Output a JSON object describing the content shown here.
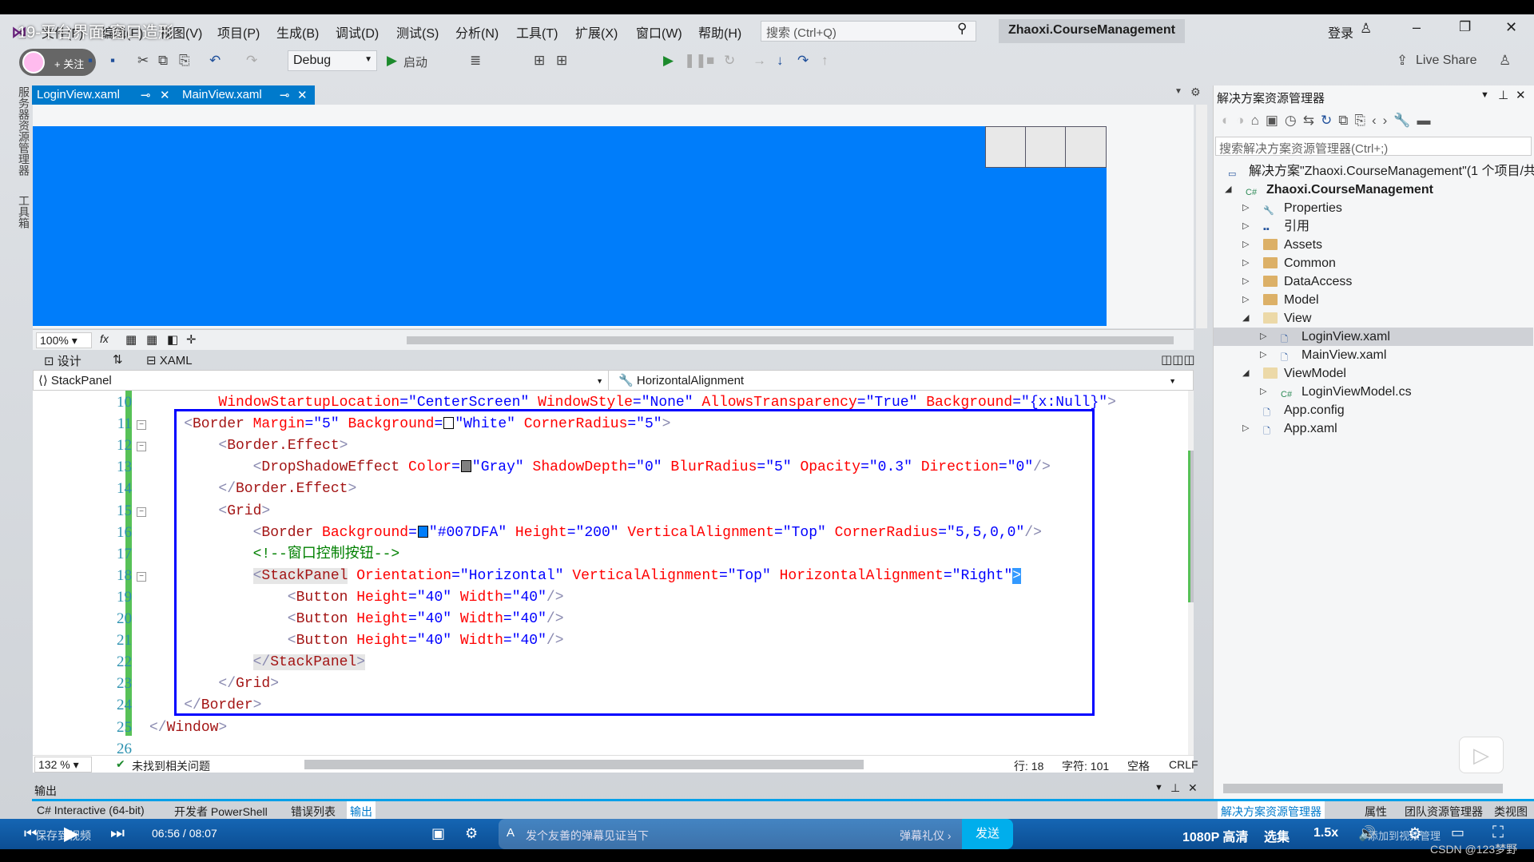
{
  "video": {
    "title": "19-平台界面-窗口造形",
    "follow": "+ 关注",
    "time": "06:56 / 08:07",
    "save": "保存到视频",
    "danmaku_placeholder": "发个友善的弹幕见证当下",
    "danmaku_etiquette": "弹幕礼仪 ›",
    "send": "发送",
    "quality": "1080P 高清",
    "episodes": "选集",
    "speed": "1.5x",
    "add_to_playlist": "添加到视频管理",
    "watermark": "CSDN @123梦野"
  },
  "menu": [
    "文件(F)",
    "编辑(E)",
    "视图(V)",
    "项目(P)",
    "生成(B)",
    "调试(D)",
    "测试(S)",
    "分析(N)",
    "工具(T)",
    "扩展(X)",
    "窗口(W)",
    "帮助(H)"
  ],
  "search": {
    "placeholder": "搜索 (Ctrl+Q)"
  },
  "project_name": "Zhaoxi.CourseManagement",
  "account": {
    "login": "登录"
  },
  "toolbar": {
    "config": "Debug",
    "start": "启动",
    "live_share": "Live Share"
  },
  "left_strip": [
    "服务器资源管理器",
    "工具箱"
  ],
  "tabs": [
    {
      "label": "LoginView.xaml",
      "active": true
    },
    {
      "label": "MainView.xaml",
      "active": false
    }
  ],
  "designer": {
    "zoom": "100%",
    "background": "#007DFA",
    "design_tab": "设计",
    "xaml_tab": "XAML"
  },
  "nav": {
    "element": "StackPanel",
    "member": "HorizontalAlignment"
  },
  "code": [
    {
      "n": "10",
      "i": 8,
      "t": [
        [
          "at",
          "WindowStartupLocation"
        ],
        [
          "q",
          "=\""
        ],
        [
          "v",
          "CenterScreen"
        ],
        [
          "q",
          "\" "
        ],
        [
          "at",
          "WindowStyle"
        ],
        [
          "q",
          "=\""
        ],
        [
          "v",
          "None"
        ],
        [
          "q",
          "\" "
        ],
        [
          "at",
          "AllowsTransparency"
        ],
        [
          "q",
          "=\""
        ],
        [
          "v",
          "True"
        ],
        [
          "q",
          "\" "
        ],
        [
          "at",
          "Background"
        ],
        [
          "q",
          "=\""
        ],
        [
          "v",
          "{x:Null}"
        ],
        [
          "q",
          "\""
        ],
        [
          "br",
          ">"
        ]
      ]
    },
    {
      "n": "11",
      "i": 4,
      "t": [
        [
          "br",
          "<"
        ],
        [
          "el",
          "Border"
        ],
        [
          "t",
          " "
        ],
        [
          "at",
          "Margin"
        ],
        [
          "q",
          "=\""
        ],
        [
          "v",
          "5"
        ],
        [
          "q",
          "\" "
        ],
        [
          "at",
          "Background"
        ],
        [
          "q",
          "="
        ],
        [
          "sw",
          "#FFFFFF"
        ],
        [
          "q",
          "\""
        ],
        [
          "v",
          "White"
        ],
        [
          "q",
          "\" "
        ],
        [
          "at",
          "CornerRadius"
        ],
        [
          "q",
          "=\""
        ],
        [
          "v",
          "5"
        ],
        [
          "q",
          "\""
        ],
        [
          "br",
          ">"
        ]
      ]
    },
    {
      "n": "12",
      "i": 8,
      "t": [
        [
          "br",
          "<"
        ],
        [
          "el",
          "Border.Effect"
        ],
        [
          "br",
          ">"
        ]
      ]
    },
    {
      "n": "13",
      "i": 12,
      "t": [
        [
          "br",
          "<"
        ],
        [
          "el",
          "DropShadowEffect"
        ],
        [
          "t",
          " "
        ],
        [
          "at",
          "Color"
        ],
        [
          "q",
          "="
        ],
        [
          "sw",
          "#808080"
        ],
        [
          "q",
          "\""
        ],
        [
          "v",
          "Gray"
        ],
        [
          "q",
          "\" "
        ],
        [
          "at",
          "ShadowDepth"
        ],
        [
          "q",
          "=\""
        ],
        [
          "v",
          "0"
        ],
        [
          "q",
          "\" "
        ],
        [
          "at",
          "BlurRadius"
        ],
        [
          "q",
          "=\""
        ],
        [
          "v",
          "5"
        ],
        [
          "q",
          "\" "
        ],
        [
          "at",
          "Opacity"
        ],
        [
          "q",
          "=\""
        ],
        [
          "v",
          "0.3"
        ],
        [
          "q",
          "\" "
        ],
        [
          "at",
          "Direction"
        ],
        [
          "q",
          "=\""
        ],
        [
          "v",
          "0"
        ],
        [
          "q",
          "\""
        ],
        [
          "br",
          "/>"
        ]
      ]
    },
    {
      "n": "14",
      "i": 8,
      "t": [
        [
          "br",
          "</"
        ],
        [
          "el",
          "Border.Effect"
        ],
        [
          "br",
          ">"
        ]
      ]
    },
    {
      "n": "15",
      "i": 8,
      "t": [
        [
          "br",
          "<"
        ],
        [
          "el",
          "Grid"
        ],
        [
          "br",
          ">"
        ]
      ]
    },
    {
      "n": "16",
      "i": 12,
      "t": [
        [
          "br",
          "<"
        ],
        [
          "el",
          "Border"
        ],
        [
          "t",
          " "
        ],
        [
          "at",
          "Background"
        ],
        [
          "q",
          "="
        ],
        [
          "sw",
          "#007DFA"
        ],
        [
          "q",
          "\""
        ],
        [
          "v",
          "#007DFA"
        ],
        [
          "q",
          "\" "
        ],
        [
          "at",
          "Height"
        ],
        [
          "q",
          "=\""
        ],
        [
          "v",
          "200"
        ],
        [
          "q",
          "\" "
        ],
        [
          "at",
          "VerticalAlignment"
        ],
        [
          "q",
          "=\""
        ],
        [
          "v",
          "Top"
        ],
        [
          "q",
          "\" "
        ],
        [
          "at",
          "CornerRadius"
        ],
        [
          "q",
          "=\""
        ],
        [
          "v",
          "5,5,0,0"
        ],
        [
          "q",
          "\""
        ],
        [
          "br",
          "/>"
        ]
      ]
    },
    {
      "n": "17",
      "i": 12,
      "t": [
        [
          "cm",
          "<!--窗口控制按钮-->"
        ]
      ]
    },
    {
      "n": "18",
      "i": 12,
      "t": [
        [
          "br",
          "<"
        ],
        [
          "el",
          "StackPanel"
        ],
        [
          "t",
          " "
        ],
        [
          "at",
          "Orientation"
        ],
        [
          "q",
          "=\""
        ],
        [
          "v",
          "Horizontal"
        ],
        [
          "q",
          "\" "
        ],
        [
          "at",
          "VerticalAlignment"
        ],
        [
          "q",
          "=\""
        ],
        [
          "v",
          "Top"
        ],
        [
          "q",
          "\" "
        ],
        [
          "at",
          "HorizontalAlignment"
        ],
        [
          "q",
          "=\""
        ],
        [
          "v",
          "Right"
        ],
        [
          "q",
          "\""
        ],
        [
          "br",
          ">"
        ]
      ]
    },
    {
      "n": "19",
      "i": 16,
      "t": [
        [
          "br",
          "<"
        ],
        [
          "el",
          "Button"
        ],
        [
          "t",
          " "
        ],
        [
          "at",
          "Height"
        ],
        [
          "q",
          "=\""
        ],
        [
          "v",
          "40"
        ],
        [
          "q",
          "\" "
        ],
        [
          "at",
          "Width"
        ],
        [
          "q",
          "=\""
        ],
        [
          "v",
          "40"
        ],
        [
          "q",
          "\""
        ],
        [
          "br",
          "/>"
        ]
      ]
    },
    {
      "n": "20",
      "i": 16,
      "t": [
        [
          "br",
          "<"
        ],
        [
          "el",
          "Button"
        ],
        [
          "t",
          " "
        ],
        [
          "at",
          "Height"
        ],
        [
          "q",
          "=\""
        ],
        [
          "v",
          "40"
        ],
        [
          "q",
          "\" "
        ],
        [
          "at",
          "Width"
        ],
        [
          "q",
          "=\""
        ],
        [
          "v",
          "40"
        ],
        [
          "q",
          "\""
        ],
        [
          "br",
          "/>"
        ]
      ]
    },
    {
      "n": "21",
      "i": 16,
      "t": [
        [
          "br",
          "<"
        ],
        [
          "el",
          "Button"
        ],
        [
          "t",
          " "
        ],
        [
          "at",
          "Height"
        ],
        [
          "q",
          "=\""
        ],
        [
          "v",
          "40"
        ],
        [
          "q",
          "\" "
        ],
        [
          "at",
          "Width"
        ],
        [
          "q",
          "=\""
        ],
        [
          "v",
          "40"
        ],
        [
          "q",
          "\""
        ],
        [
          "br",
          "/>"
        ]
      ]
    },
    {
      "n": "22",
      "i": 12,
      "t": [
        [
          "br",
          "</"
        ],
        [
          "el",
          "StackPanel"
        ],
        [
          "br",
          ">"
        ]
      ]
    },
    {
      "n": "23",
      "i": 8,
      "t": [
        [
          "br",
          "</"
        ],
        [
          "el",
          "Grid"
        ],
        [
          "br",
          ">"
        ]
      ]
    },
    {
      "n": "24",
      "i": 4,
      "t": [
        [
          "br",
          "</"
        ],
        [
          "el",
          "Border"
        ],
        [
          "br",
          ">"
        ]
      ]
    },
    {
      "n": "25",
      "i": 0,
      "t": [
        [
          "br",
          "</"
        ],
        [
          "el",
          "Window"
        ],
        [
          "br",
          ">"
        ]
      ]
    },
    {
      "n": "26",
      "i": 0,
      "t": []
    }
  ],
  "status": {
    "zoom": "132 %",
    "issues": "未找到相关问题",
    "line": "行: 18",
    "char": "字符: 101",
    "spaces": "空格",
    "eol": "CRLF"
  },
  "output": {
    "title": "输出"
  },
  "bottom_tabs": [
    "C# Interactive (64-bit)",
    "开发者 PowerShell",
    "错误列表",
    "输出"
  ],
  "right_tabs": [
    "解决方案资源管理器",
    "属性",
    "团队资源管理器",
    "类视图"
  ],
  "solution": {
    "title": "解决方案资源管理器",
    "search_placeholder": "搜索解决方案资源管理器(Ctrl+;)",
    "items": [
      {
        "label": "解决方案\"Zhaoxi.CourseManagement\"(1 个项目/共",
        "d": 0,
        "icon": "solution-icon",
        "exp": ""
      },
      {
        "label": "Zhaoxi.CourseManagement",
        "d": 1,
        "icon": "csproj-icon",
        "exp": "open",
        "bold": true
      },
      {
        "label": "Properties",
        "d": 2,
        "icon": "wrench-icon",
        "exp": "closed"
      },
      {
        "label": "引用",
        "d": 2,
        "icon": "references-icon",
        "exp": "closed"
      },
      {
        "label": "Assets",
        "d": 2,
        "icon": "folder-icon",
        "exp": "closed"
      },
      {
        "label": "Common",
        "d": 2,
        "icon": "folder-icon",
        "exp": "closed"
      },
      {
        "label": "DataAccess",
        "d": 2,
        "icon": "folder-icon",
        "exp": "closed"
      },
      {
        "label": "Model",
        "d": 2,
        "icon": "folder-icon",
        "exp": "closed"
      },
      {
        "label": "View",
        "d": 2,
        "icon": "folder-open-icon",
        "exp": "open"
      },
      {
        "label": "LoginView.xaml",
        "d": 3,
        "icon": "xaml-file-icon",
        "exp": "closed",
        "selected": true
      },
      {
        "label": "MainView.xaml",
        "d": 3,
        "icon": "xaml-file-icon",
        "exp": "closed"
      },
      {
        "label": "ViewModel",
        "d": 2,
        "icon": "folder-open-icon",
        "exp": "open"
      },
      {
        "label": "LoginViewModel.cs",
        "d": 3,
        "icon": "csharp-file-icon",
        "exp": "closed"
      },
      {
        "label": "App.config",
        "d": 2,
        "icon": "config-file-icon",
        "exp": ""
      },
      {
        "label": "App.xaml",
        "d": 2,
        "icon": "xaml-file-icon",
        "exp": "closed"
      }
    ]
  }
}
